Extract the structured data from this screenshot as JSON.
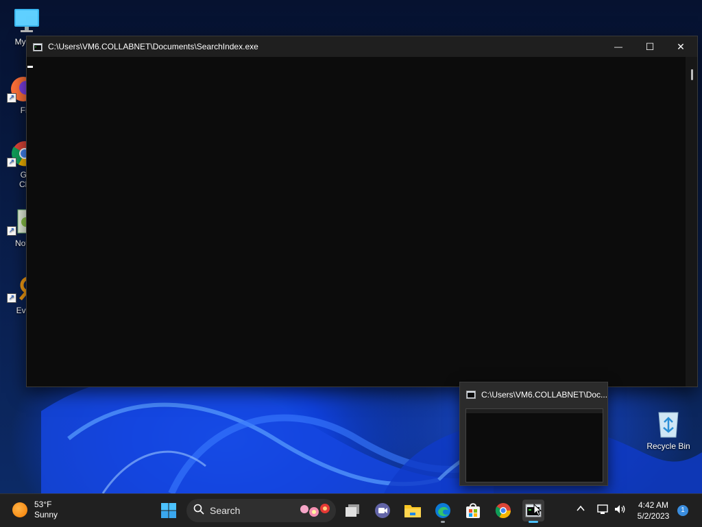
{
  "desktop": {
    "icons": [
      {
        "label": "My Co"
      },
      {
        "label": "Fire"
      },
      {
        "label": "Goo",
        "label2": "Chro"
      },
      {
        "label": "Notep"
      },
      {
        "label": "Every"
      }
    ],
    "recycle_bin": "Recycle Bin"
  },
  "console": {
    "title": "C:\\Users\\VM6.COLLABNET\\Documents\\SearchIndex.exe",
    "minimize": "—",
    "maximize": "☐",
    "close": "✕"
  },
  "preview": {
    "title": "C:\\Users\\VM6.COLLABNET\\Doc..."
  },
  "taskbar": {
    "weather": {
      "temp": "53°F",
      "condition": "Sunny"
    },
    "search_label": "Search",
    "clock": {
      "time": "4:42 AM",
      "date": "5/2/2023"
    },
    "notification_count": "1"
  },
  "colors": {
    "accent": "#4cc2ff",
    "console_bg": "#0c0c0c",
    "taskbar_bg": "#202020"
  }
}
